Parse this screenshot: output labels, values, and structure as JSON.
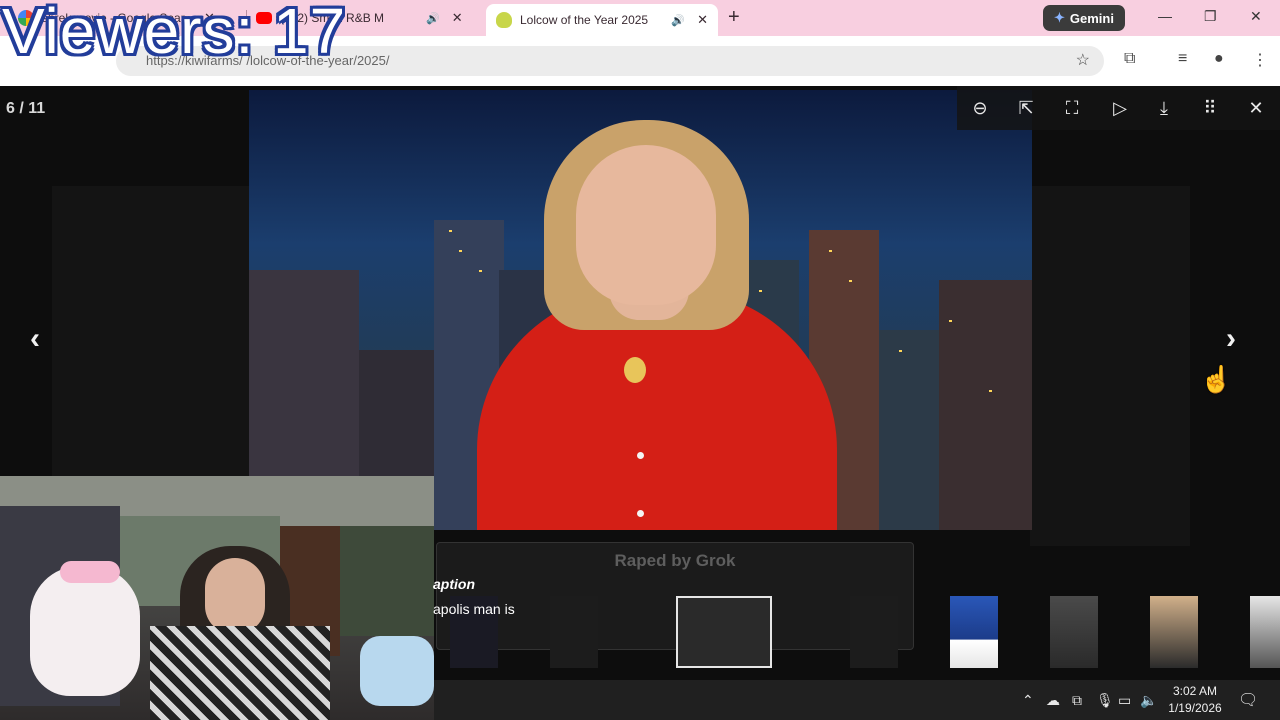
{
  "browser": {
    "tabs": [
      {
        "title": "shrek movie - Google Sear",
        "favicon": "google-icon"
      },
      {
        "title": "(212) Sm         th       R&B M",
        "favicon": "youtube-icon"
      },
      {
        "title": "Lolcow of the Year 2025",
        "favicon": "kiwi-icon"
      }
    ],
    "gemini_label": "Gemini",
    "address": "https://kiwifarms/     /lolcow-of-the-year/2025/",
    "accent": "#f8cfe0"
  },
  "viewer": {
    "counter": "6 / 11",
    "caption_title": "Raped by Grok",
    "controls": [
      "zoom-out-icon",
      "open-new-window-icon",
      "fullscreen-icon",
      "play-icon",
      "download-icon",
      "grid-icon",
      "close-icon"
    ]
  },
  "stream": {
    "viewers_label": "Viewers: 17",
    "caption_line1": "aption",
    "caption_line2": "apolis man is"
  },
  "taskbar": {
    "time": "3:02 AM",
    "date": "1/19/2026"
  }
}
